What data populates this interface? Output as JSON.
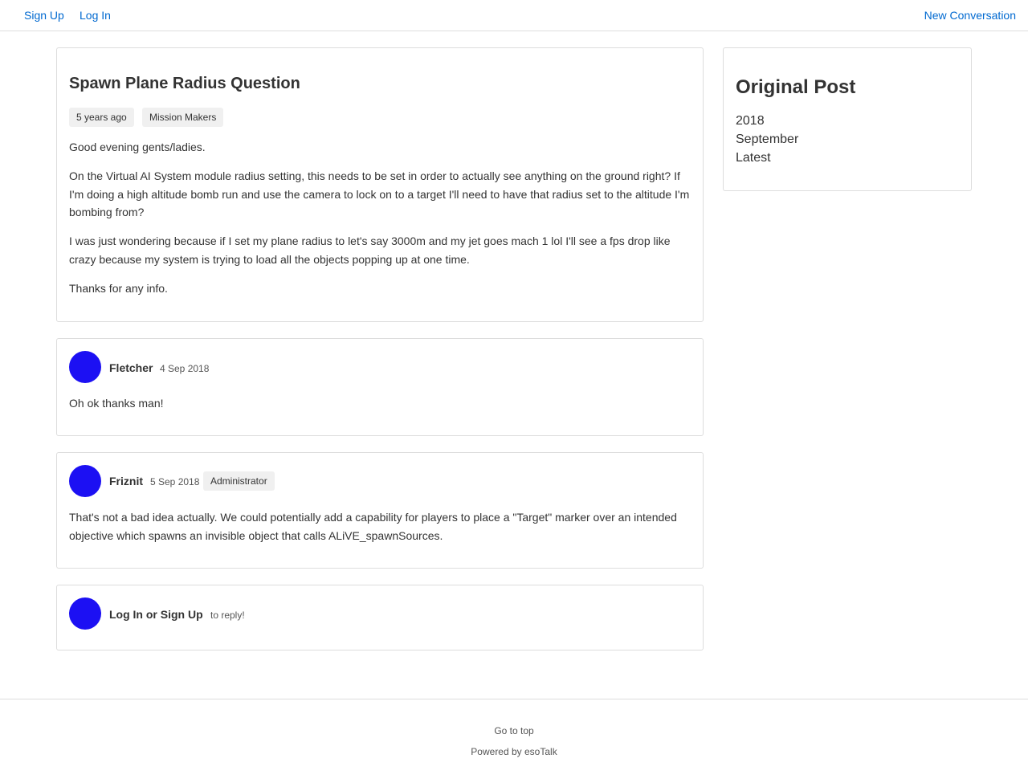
{
  "header": {
    "signup": "Sign Up",
    "login": "Log In",
    "new_conversation": "New Conversation"
  },
  "post": {
    "title": "Spawn Plane Radius Question",
    "tags": [
      "5 years ago",
      "Mission Makers"
    ],
    "paragraphs": [
      "Good evening gents/ladies.",
      "On the Virtual AI System module radius setting, this needs to be set in order to actually see anything on the ground right? If I'm doing a high altitude bomb run and use the camera to lock on to a target I'll need to have that radius set to the altitude I'm bombing from?",
      "I was just wondering because if I set my plane radius to let's say 3000m and my jet goes mach 1 lol I'll see a fps drop like crazy because my system is trying to load all the objects popping up at one time.",
      "Thanks for any info."
    ]
  },
  "replies": [
    {
      "author": "Fletcher",
      "date": "4 Sep 2018",
      "role": "",
      "body": "Oh ok thanks man!"
    },
    {
      "author": "Friznit",
      "date": "5 Sep 2018",
      "role": "Administrator",
      "body": "That's not a bad idea actually. We could potentially add a capability for players to place a \"Target\" marker over an intended objective which spawns an invisible object that calls ALiVE_spawnSources."
    }
  ],
  "reply_prompt": {
    "action": "Log In or Sign Up",
    "suffix": "to reply!"
  },
  "sidebar": {
    "title": "Original Post",
    "items": [
      "2018",
      "September",
      "Latest"
    ]
  },
  "footer": {
    "top": "Go to top",
    "powered": "Powered by esoTalk"
  },
  "colors": {
    "avatar": "#1c10f3",
    "link": "#0069d0"
  }
}
